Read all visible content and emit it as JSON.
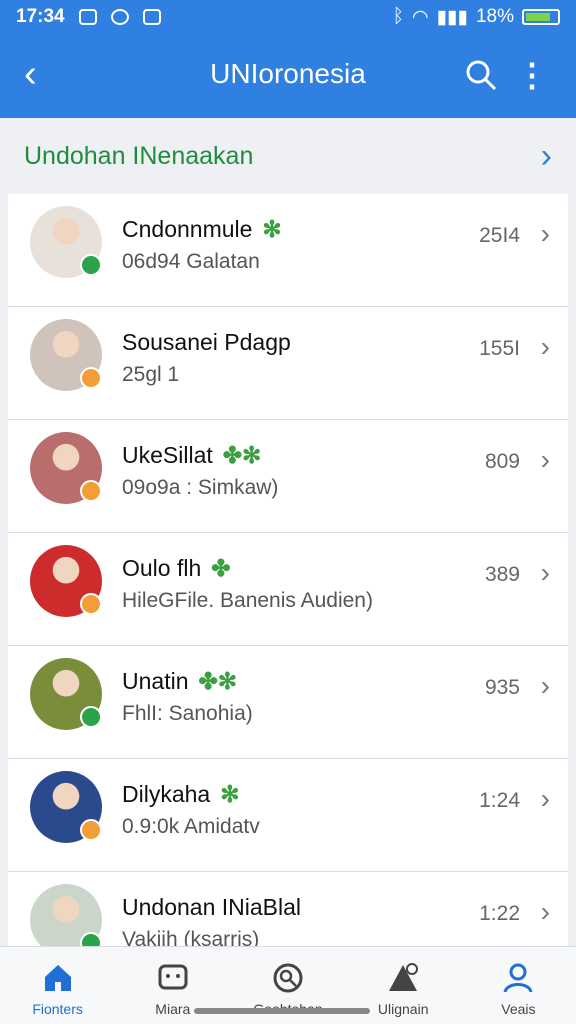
{
  "status": {
    "time": "17:34",
    "battery": "18%"
  },
  "app_bar": {
    "title": "UNIoronesia"
  },
  "section": {
    "label": "Undohan INenaakan"
  },
  "rows": [
    {
      "name": "Cndonnmule",
      "sub": "06d94 Galatan",
      "count": "25I4",
      "leaf": "✻",
      "badge": "#2aa34a",
      "avatar": "#e8e1da"
    },
    {
      "name": "Sousanei  Pdagp",
      "sub": "25gl 1",
      "count": "155I",
      "leaf": "",
      "badge": "#f29d38",
      "avatar": "#cfc3bb"
    },
    {
      "name": "UkeSillat",
      "sub": "09o9a : Simkaw)",
      "count": "809",
      "leaf": "✤✻",
      "badge": "#f29d38",
      "avatar": "#b96d6d"
    },
    {
      "name": "Oulo flh",
      "sub": "HileGFile. Banenis Audien)",
      "count": "389",
      "leaf": "✤",
      "badge": "#f29d38",
      "avatar": "#cc2c2c"
    },
    {
      "name": "Unatin",
      "sub": "FhlI: Sanohia)",
      "count": "935",
      "leaf": "✤✻",
      "badge": "#2aa34a",
      "avatar": "#7a8d3a"
    },
    {
      "name": "Dilykaha",
      "sub": "0.9:0k Amidatv",
      "count": "1:24",
      "leaf": "✻",
      "badge": "#f29d38",
      "avatar": "#2b4a8e"
    },
    {
      "name": "Undonan INiaBlal",
      "sub": "Vakiih (ksarris)",
      "count": "1:22",
      "leaf": "",
      "badge": "#2aa34a",
      "avatar": "#c9d6c9"
    }
  ],
  "bottom_nav": [
    {
      "label": "Fionters",
      "icon": "home-icon"
    },
    {
      "label": "Miara",
      "icon": "chat-icon"
    },
    {
      "label": "Goobtoban",
      "icon": "search-circle-icon"
    },
    {
      "label": "Ulignain",
      "icon": "alert-icon"
    },
    {
      "label": "Veais",
      "icon": "profile-icon"
    }
  ],
  "colors": {
    "primary": "#2f80e0",
    "section_green": "#1e8e3e"
  }
}
